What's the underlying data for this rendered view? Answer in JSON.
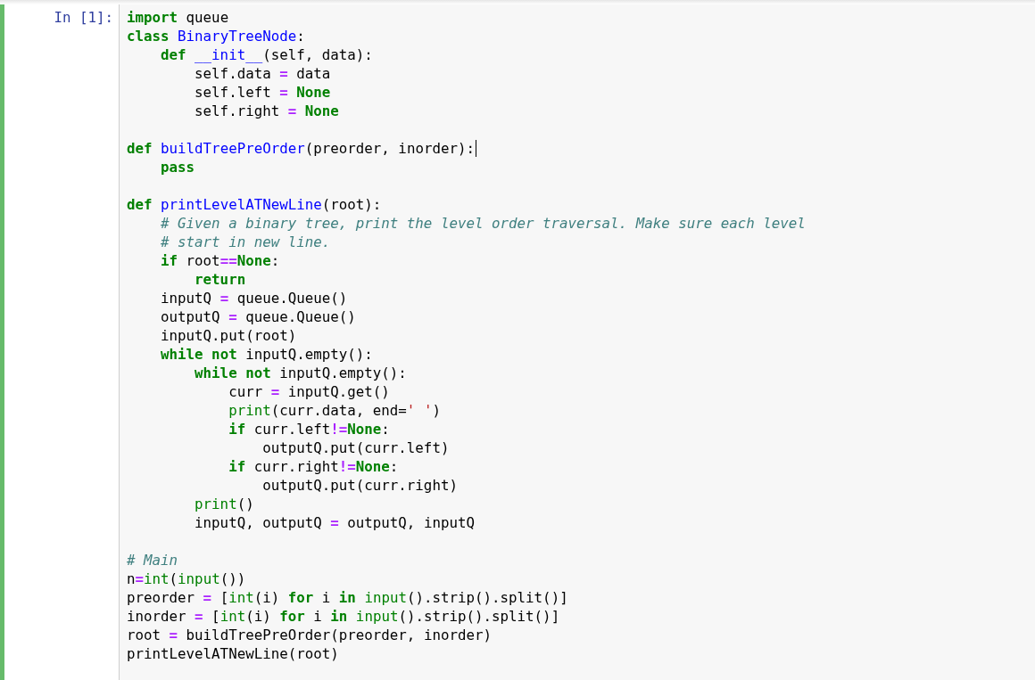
{
  "cell": {
    "prompt": "In [1]:",
    "selected": true,
    "lines": [
      {
        "kind": "code",
        "cursor": false,
        "tokens": [
          {
            "text": "import",
            "kind": "keyword"
          },
          {
            "text": " queue",
            "kind": "plain"
          }
        ]
      },
      {
        "kind": "code",
        "cursor": false,
        "tokens": [
          {
            "text": "class",
            "kind": "keyword"
          },
          {
            "text": " BinaryTreeNode",
            "kind": "name"
          },
          {
            "text": ":",
            "kind": "plain"
          }
        ]
      },
      {
        "kind": "code",
        "cursor": false,
        "tokens": [
          {
            "text": "    def",
            "kind": "keyword"
          },
          {
            "text": " __init__",
            "kind": "name"
          },
          {
            "text": "(self, data):",
            "kind": "plain"
          }
        ]
      },
      {
        "kind": "code",
        "cursor": false,
        "tokens": [
          {
            "text": "        self.data ",
            "kind": "plain"
          },
          {
            "text": "=",
            "kind": "op"
          },
          {
            "text": " data",
            "kind": "plain"
          }
        ]
      },
      {
        "kind": "code",
        "cursor": false,
        "tokens": [
          {
            "text": "        self.left ",
            "kind": "plain"
          },
          {
            "text": "=",
            "kind": "op"
          },
          {
            "text": " None",
            "kind": "keyword"
          }
        ]
      },
      {
        "kind": "code",
        "cursor": false,
        "tokens": [
          {
            "text": "        self.right ",
            "kind": "plain"
          },
          {
            "text": "=",
            "kind": "op"
          },
          {
            "text": " None",
            "kind": "keyword"
          }
        ]
      },
      {
        "kind": "blank"
      },
      {
        "kind": "code",
        "cursor": true,
        "tokens": [
          {
            "text": "def",
            "kind": "keyword"
          },
          {
            "text": " buildTreePreOrder",
            "kind": "name"
          },
          {
            "text": "(preorder, inorder):",
            "kind": "plain"
          }
        ]
      },
      {
        "kind": "code",
        "cursor": false,
        "tokens": [
          {
            "text": "    pass",
            "kind": "keyword"
          }
        ]
      },
      {
        "kind": "blank"
      },
      {
        "kind": "code",
        "cursor": false,
        "tokens": [
          {
            "text": "def",
            "kind": "keyword"
          },
          {
            "text": " printLevelATNewLine",
            "kind": "name"
          },
          {
            "text": "(root):",
            "kind": "plain"
          }
        ]
      },
      {
        "kind": "code",
        "cursor": false,
        "tokens": [
          {
            "text": "    # Given a binary tree, print the level order traversal. Make sure each level",
            "kind": "comment"
          }
        ]
      },
      {
        "kind": "code",
        "cursor": false,
        "tokens": [
          {
            "text": "    # start in new line.",
            "kind": "comment"
          }
        ]
      },
      {
        "kind": "code",
        "cursor": false,
        "tokens": [
          {
            "text": "    if",
            "kind": "keyword"
          },
          {
            "text": " root",
            "kind": "plain"
          },
          {
            "text": "==",
            "kind": "op"
          },
          {
            "text": "None",
            "kind": "keyword"
          },
          {
            "text": ":",
            "kind": "plain"
          }
        ]
      },
      {
        "kind": "code",
        "cursor": false,
        "tokens": [
          {
            "text": "        return",
            "kind": "keyword"
          }
        ]
      },
      {
        "kind": "code",
        "cursor": false,
        "tokens": [
          {
            "text": "    inputQ ",
            "kind": "plain"
          },
          {
            "text": "=",
            "kind": "op"
          },
          {
            "text": " queue.Queue()",
            "kind": "plain"
          }
        ]
      },
      {
        "kind": "code",
        "cursor": false,
        "tokens": [
          {
            "text": "    outputQ ",
            "kind": "plain"
          },
          {
            "text": "=",
            "kind": "op"
          },
          {
            "text": " queue.Queue()",
            "kind": "plain"
          }
        ]
      },
      {
        "kind": "code",
        "cursor": false,
        "tokens": [
          {
            "text": "    inputQ.put(root)",
            "kind": "plain"
          }
        ]
      },
      {
        "kind": "code",
        "cursor": false,
        "tokens": [
          {
            "text": "    while",
            "kind": "keyword"
          },
          {
            "text": " not",
            "kind": "keyword"
          },
          {
            "text": " inputQ.empty():",
            "kind": "plain"
          }
        ]
      },
      {
        "kind": "code",
        "cursor": false,
        "tokens": [
          {
            "text": "        while",
            "kind": "keyword"
          },
          {
            "text": " not",
            "kind": "keyword"
          },
          {
            "text": " inputQ.empty():",
            "kind": "plain"
          }
        ]
      },
      {
        "kind": "code",
        "cursor": false,
        "tokens": [
          {
            "text": "            curr ",
            "kind": "plain"
          },
          {
            "text": "=",
            "kind": "op"
          },
          {
            "text": " inputQ.get()",
            "kind": "plain"
          }
        ]
      },
      {
        "kind": "code",
        "cursor": false,
        "tokens": [
          {
            "text": "            print",
            "kind": "builtin"
          },
          {
            "text": "(curr.data, end=",
            "kind": "plain"
          },
          {
            "text": "' '",
            "kind": "string"
          },
          {
            "text": ")",
            "kind": "plain"
          }
        ]
      },
      {
        "kind": "code",
        "cursor": false,
        "tokens": [
          {
            "text": "            if",
            "kind": "keyword"
          },
          {
            "text": " curr.left",
            "kind": "plain"
          },
          {
            "text": "!=",
            "kind": "op"
          },
          {
            "text": "None",
            "kind": "keyword"
          },
          {
            "text": ":",
            "kind": "plain"
          }
        ]
      },
      {
        "kind": "code",
        "cursor": false,
        "tokens": [
          {
            "text": "                outputQ.put(curr.left)",
            "kind": "plain"
          }
        ]
      },
      {
        "kind": "code",
        "cursor": false,
        "tokens": [
          {
            "text": "            if",
            "kind": "keyword"
          },
          {
            "text": " curr.right",
            "kind": "plain"
          },
          {
            "text": "!=",
            "kind": "op"
          },
          {
            "text": "None",
            "kind": "keyword"
          },
          {
            "text": ":",
            "kind": "plain"
          }
        ]
      },
      {
        "kind": "code",
        "cursor": false,
        "tokens": [
          {
            "text": "                outputQ.put(curr.right)",
            "kind": "plain"
          }
        ]
      },
      {
        "kind": "code",
        "cursor": false,
        "tokens": [
          {
            "text": "        print",
            "kind": "builtin"
          },
          {
            "text": "()",
            "kind": "plain"
          }
        ]
      },
      {
        "kind": "code",
        "cursor": false,
        "tokens": [
          {
            "text": "        inputQ, outputQ ",
            "kind": "plain"
          },
          {
            "text": "=",
            "kind": "op"
          },
          {
            "text": " outputQ, inputQ",
            "kind": "plain"
          }
        ]
      },
      {
        "kind": "blank"
      },
      {
        "kind": "code",
        "cursor": false,
        "tokens": [
          {
            "text": "# Main",
            "kind": "comment"
          }
        ]
      },
      {
        "kind": "code",
        "cursor": false,
        "tokens": [
          {
            "text": "n",
            "kind": "plain"
          },
          {
            "text": "=",
            "kind": "op"
          },
          {
            "text": "int",
            "kind": "builtin"
          },
          {
            "text": "(",
            "kind": "plain"
          },
          {
            "text": "input",
            "kind": "builtin"
          },
          {
            "text": "())",
            "kind": "plain"
          }
        ]
      },
      {
        "kind": "code",
        "cursor": false,
        "tokens": [
          {
            "text": "preorder ",
            "kind": "plain"
          },
          {
            "text": "=",
            "kind": "op"
          },
          {
            "text": " [",
            "kind": "plain"
          },
          {
            "text": "int",
            "kind": "builtin"
          },
          {
            "text": "(i) ",
            "kind": "plain"
          },
          {
            "text": "for",
            "kind": "keyword"
          },
          {
            "text": " i ",
            "kind": "plain"
          },
          {
            "text": "in",
            "kind": "keyword"
          },
          {
            "text": " input",
            "kind": "builtin"
          },
          {
            "text": "().strip().split()]",
            "kind": "plain"
          }
        ]
      },
      {
        "kind": "code",
        "cursor": false,
        "tokens": [
          {
            "text": "inorder ",
            "kind": "plain"
          },
          {
            "text": "=",
            "kind": "op"
          },
          {
            "text": " [",
            "kind": "plain"
          },
          {
            "text": "int",
            "kind": "builtin"
          },
          {
            "text": "(i) ",
            "kind": "plain"
          },
          {
            "text": "for",
            "kind": "keyword"
          },
          {
            "text": " i ",
            "kind": "plain"
          },
          {
            "text": "in",
            "kind": "keyword"
          },
          {
            "text": " input",
            "kind": "builtin"
          },
          {
            "text": "().strip().split()]",
            "kind": "plain"
          }
        ]
      },
      {
        "kind": "code",
        "cursor": false,
        "tokens": [
          {
            "text": "root ",
            "kind": "plain"
          },
          {
            "text": "=",
            "kind": "op"
          },
          {
            "text": " buildTreePreOrder(preorder, inorder)",
            "kind": "plain"
          }
        ]
      },
      {
        "kind": "code",
        "cursor": false,
        "tokens": [
          {
            "text": "printLevelATNewLine(root)",
            "kind": "plain"
          }
        ]
      }
    ]
  }
}
